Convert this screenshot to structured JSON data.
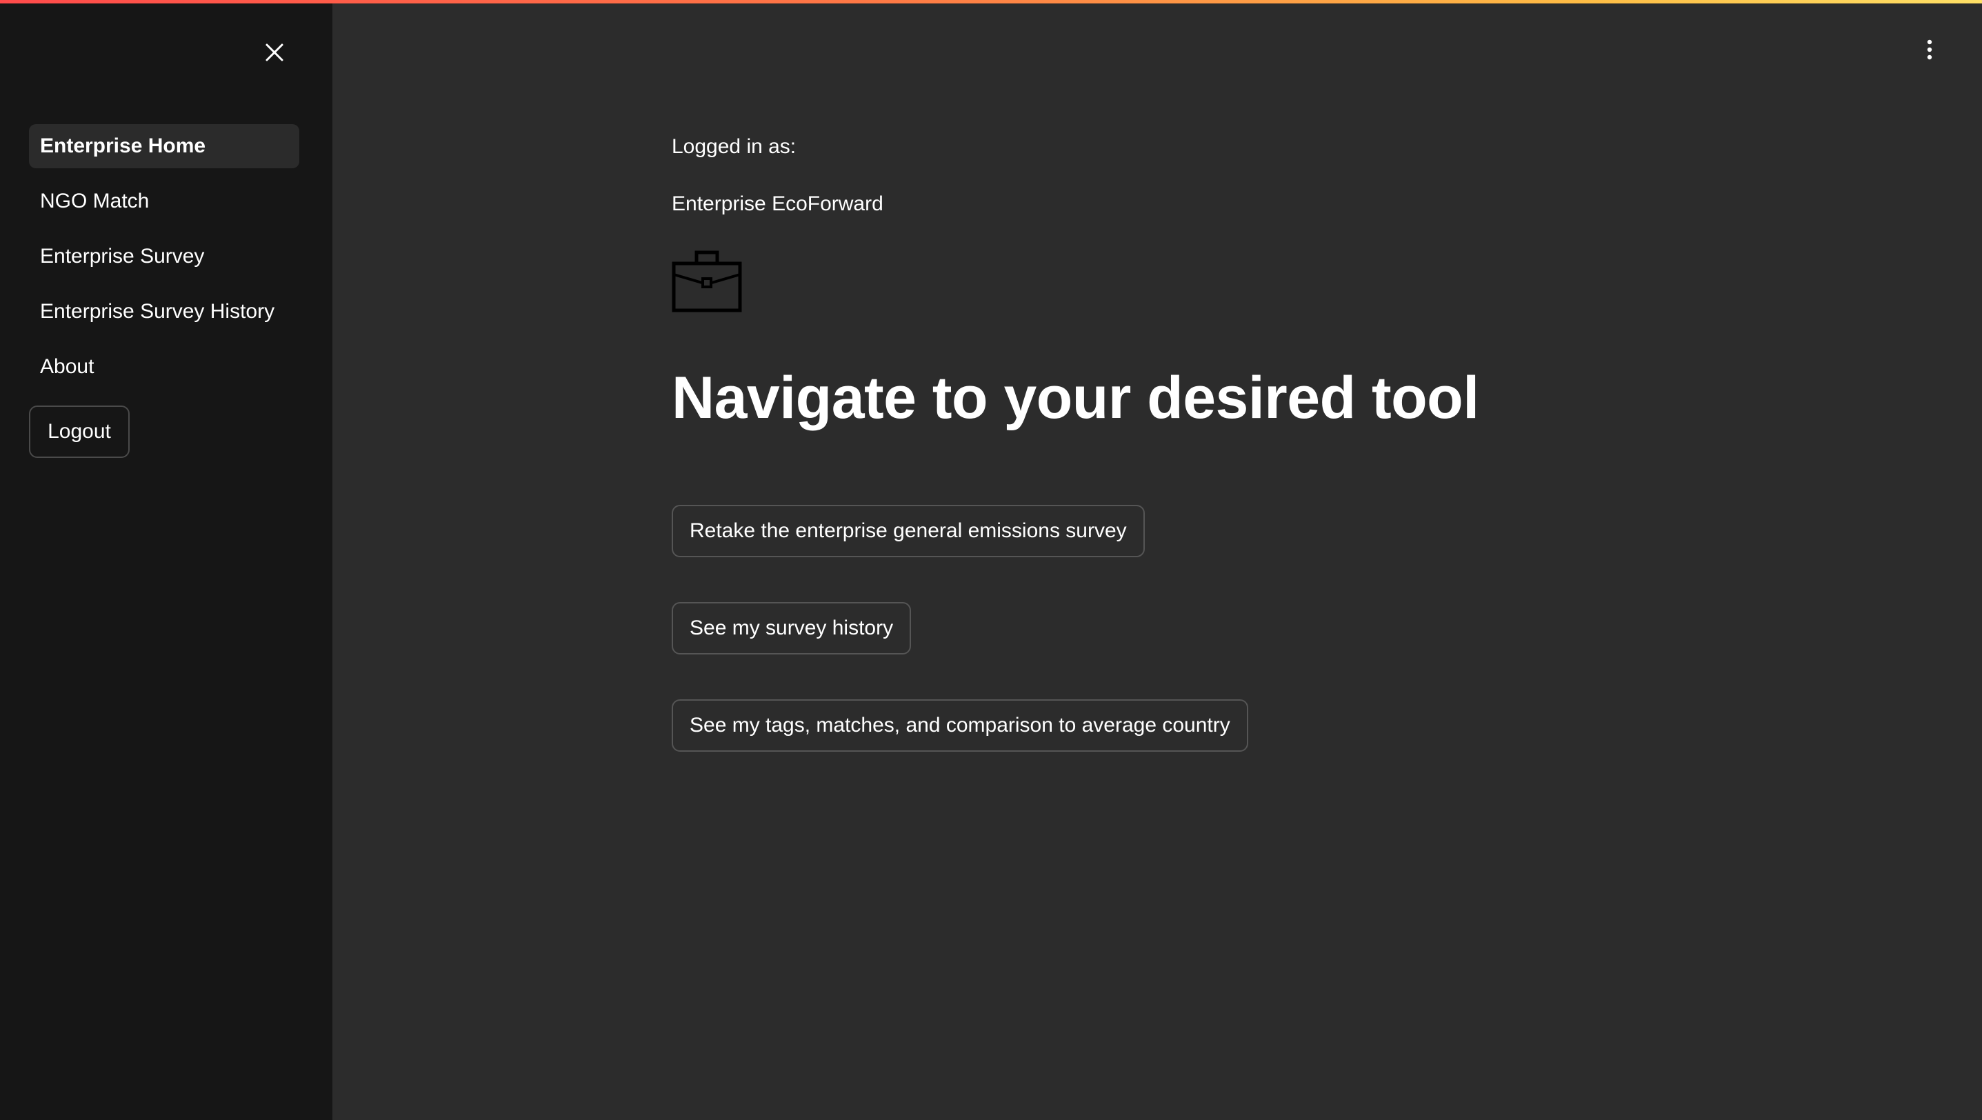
{
  "sidebar": {
    "close_icon": "close-icon",
    "items": [
      {
        "label": "Enterprise Home",
        "active": true
      },
      {
        "label": "NGO Match",
        "active": false
      },
      {
        "label": "Enterprise Survey",
        "active": false
      },
      {
        "label": "Enterprise Survey History",
        "active": false
      },
      {
        "label": "About",
        "active": false
      }
    ],
    "logout_label": "Logout"
  },
  "header": {
    "menu_icon": "kebab-menu-icon",
    "gradient_colors": [
      "#ff4b4b",
      "#ff7a45",
      "#ffbd45",
      "#ffe066"
    ]
  },
  "main": {
    "logged_in_label": "Logged in as:",
    "user_name": "Enterprise EcoForward",
    "icon": "briefcase-icon",
    "heading": "Navigate to your desired tool",
    "buttons": [
      {
        "label": "Retake the enterprise general emissions survey"
      },
      {
        "label": "See my survey history"
      },
      {
        "label": "See my tags, matches, and comparison to average country"
      }
    ]
  },
  "colors": {
    "sidebar_bg": "#161616",
    "main_bg": "#2c2c2c",
    "active_item_bg": "#2b2b2b",
    "text": "#ffffff"
  }
}
